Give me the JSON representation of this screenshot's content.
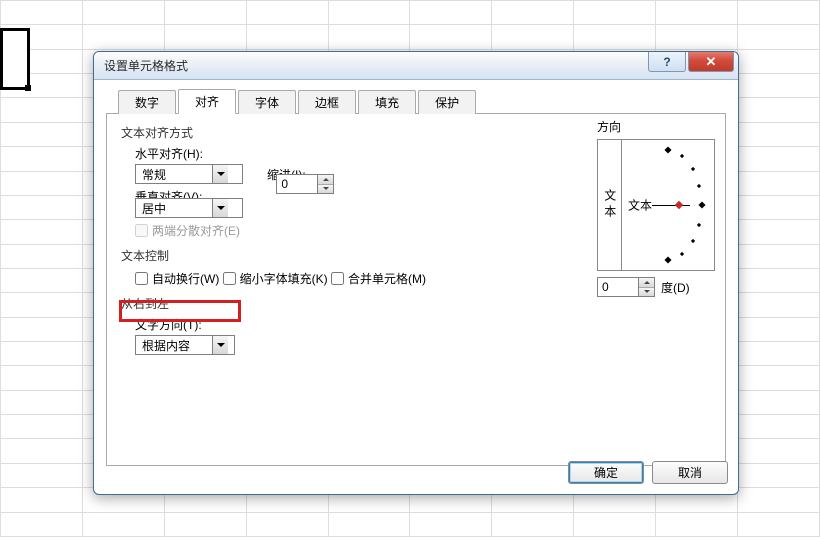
{
  "dialog": {
    "title": "设置单元格格式",
    "help": "?",
    "close": "✕"
  },
  "tabs": [
    "数字",
    "对齐",
    "字体",
    "边框",
    "填充",
    "保护"
  ],
  "active_tab": 1,
  "align": {
    "group_label": "文本对齐方式",
    "h_label": "水平对齐(H):",
    "h_value": "常规",
    "indent_label": "缩进(I):",
    "indent_value": "0",
    "v_label": "垂直对齐(V):",
    "v_value": "居中",
    "justify_label": "两端分散对齐(E)"
  },
  "text_ctrl": {
    "group_label": "文本控制",
    "wrap_label": "自动换行(W)",
    "shrink_label": "缩小字体填充(K)",
    "merge_label": "合并单元格(M)"
  },
  "rtl": {
    "group_label": "从右到左",
    "dir_label": "文字方向(T):",
    "dir_value": "根据内容"
  },
  "orient": {
    "group_label": "方向",
    "vertical_text": "文本",
    "horizontal_text": "文本",
    "deg_value": "0",
    "deg_label": "度(D)"
  },
  "footer": {
    "ok": "确定",
    "cancel": "取消"
  }
}
